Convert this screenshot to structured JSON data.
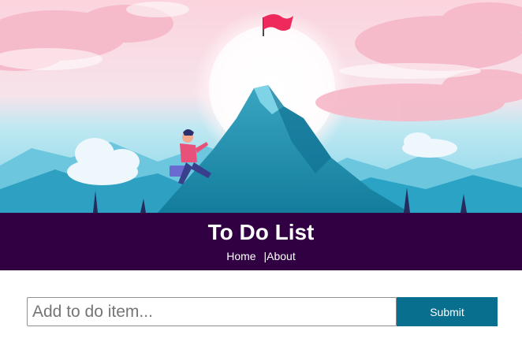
{
  "header": {
    "title": "To Do List",
    "nav": {
      "home_label": "Home",
      "separator": "|",
      "about_label": "About"
    }
  },
  "form": {
    "input_placeholder": "Add to do item...",
    "input_value": "",
    "submit_label": "Submit"
  },
  "colors": {
    "header_background": "#300042",
    "submit_background": "#086f8e",
    "flag": "#ee2a5c"
  },
  "hero_image": {
    "icon": "mountain-climber-illustration"
  }
}
